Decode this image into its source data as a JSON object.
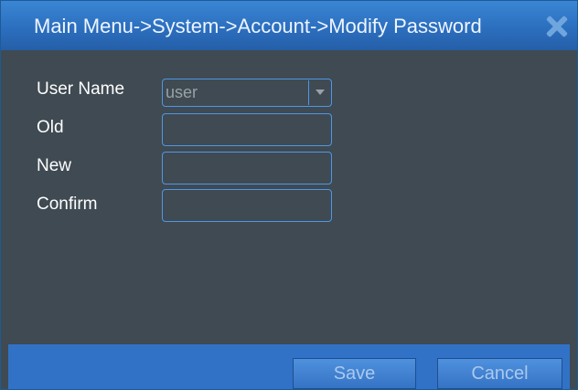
{
  "window": {
    "title": "Main Menu->System->Account->Modify Password"
  },
  "form": {
    "user_name_label": "User Name",
    "user_name_value": "user",
    "old_label": "Old",
    "new_label": "New",
    "confirm_label": "Confirm",
    "old_value": "",
    "new_value": "",
    "confirm_value": ""
  },
  "buttons": {
    "save": "Save",
    "cancel": "Cancel"
  },
  "icons": {
    "close": "close-icon",
    "dropdown": "chevron-down-icon"
  },
  "colors": {
    "title_bar": "#2c6fbf",
    "panel": "#3f4a52",
    "field_border": "#4f97e6",
    "footer": "#3172c7"
  }
}
